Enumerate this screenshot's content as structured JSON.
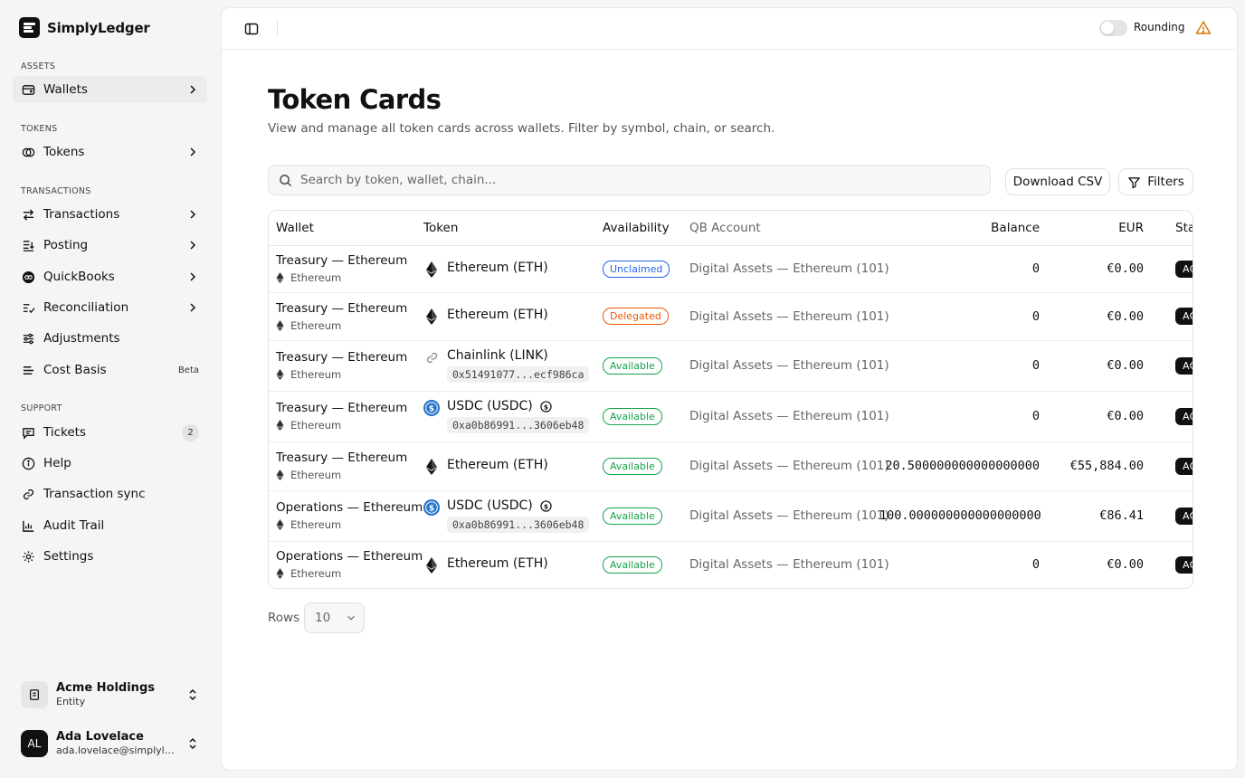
{
  "app": {
    "name": "SimplyLedger"
  },
  "sidebar": {
    "sections": {
      "assets": "ASSETS",
      "tokens": "TOKENS",
      "transactions": "TRANSACTIONS",
      "support": "SUPPORT"
    },
    "items": {
      "wallets": "Wallets",
      "tokens": "Tokens",
      "transactions": "Transactions",
      "posting": "Posting",
      "quickbooks": "QuickBooks",
      "reconciliation": "Reconciliation",
      "adjustments": "Adjustments",
      "cost_basis": "Cost Basis",
      "cost_basis_badge": "Beta",
      "tickets": "Tickets",
      "tickets_badge": "2",
      "help": "Help",
      "transaction_sync": "Transaction sync",
      "audit_trail": "Audit Trail",
      "settings": "Settings"
    },
    "entity": {
      "name": "Acme Holdings",
      "type": "Entity"
    },
    "user": {
      "initials": "AL",
      "name": "Ada Lovelace",
      "email": "ada.lovelace@simplyledger.com"
    }
  },
  "topbar": {
    "rounding_label": "Rounding",
    "rounding_on": false
  },
  "page": {
    "title": "Token Cards",
    "subtitle": "View and manage all token cards across wallets. Filter by symbol, chain, or search."
  },
  "search": {
    "placeholder": "Search by token, wallet, chain..."
  },
  "actions": {
    "download_csv": "Download CSV",
    "filters": "Filters"
  },
  "table": {
    "columns": {
      "wallet": "Wallet",
      "token": "Token",
      "availability": "Availability",
      "qb_account": "QB Account",
      "balance": "Balance",
      "eur": "EUR",
      "status": "Status"
    },
    "rows": [
      {
        "wallet": "Treasury — Ethereum",
        "chain": "Ethereum",
        "token": "Ethereum (ETH)",
        "token_icon": "eth",
        "address": "",
        "availability": "Unclaimed",
        "qb_account": "Digital Assets — Ethereum (101)",
        "balance": "0",
        "eur": "€0.00",
        "status": "ACTIVE"
      },
      {
        "wallet": "Treasury — Ethereum",
        "chain": "Ethereum",
        "token": "Ethereum (ETH)",
        "token_icon": "eth",
        "address": "",
        "availability": "Delegated",
        "qb_account": "Digital Assets — Ethereum (101)",
        "balance": "0",
        "eur": "€0.00",
        "status": "ACTIVE"
      },
      {
        "wallet": "Treasury — Ethereum",
        "chain": "Ethereum",
        "token": "Chainlink (LINK)",
        "token_icon": "link",
        "address": "0x51491077...ecf986ca",
        "availability": "Available",
        "qb_account": "Digital Assets — Ethereum (101)",
        "balance": "0",
        "eur": "€0.00",
        "status": "ACTIVE"
      },
      {
        "wallet": "Treasury — Ethereum",
        "chain": "Ethereum",
        "token": "USDC (USDC)",
        "token_icon": "usdc",
        "address": "0xa0b86991...3606eb48",
        "availability": "Available",
        "qb_account": "Digital Assets — Ethereum (101)",
        "balance": "0",
        "eur": "€0.00",
        "status": "ACTIVE"
      },
      {
        "wallet": "Treasury — Ethereum",
        "chain": "Ethereum",
        "token": "Ethereum (ETH)",
        "token_icon": "eth",
        "address": "",
        "availability": "Available",
        "qb_account": "Digital Assets — Ethereum (101)",
        "balance": "20.500000000000000000",
        "eur": "€55,884.00",
        "status": "ACTIVE"
      },
      {
        "wallet": "Operations — Ethereum",
        "chain": "Ethereum",
        "token": "USDC (USDC)",
        "token_icon": "usdc",
        "address": "0xa0b86991...3606eb48",
        "availability": "Available",
        "qb_account": "Digital Assets — Ethereum (101)",
        "balance": "100.000000000000000000",
        "eur": "€86.41",
        "status": "ACTIVE"
      },
      {
        "wallet": "Operations — Ethereum",
        "chain": "Ethereum",
        "token": "Ethereum (ETH)",
        "token_icon": "eth",
        "address": "",
        "availability": "Available",
        "qb_account": "Digital Assets — Ethereum (101)",
        "balance": "0",
        "eur": "€0.00",
        "status": "ACTIVE"
      }
    ]
  },
  "pagination": {
    "rows_label": "Rows",
    "rows_value": "10"
  },
  "colors": {
    "unclaimed": "#2563eb",
    "delegated": "#ea580c",
    "available": "#16a34a",
    "usdc": "#2775ca"
  }
}
